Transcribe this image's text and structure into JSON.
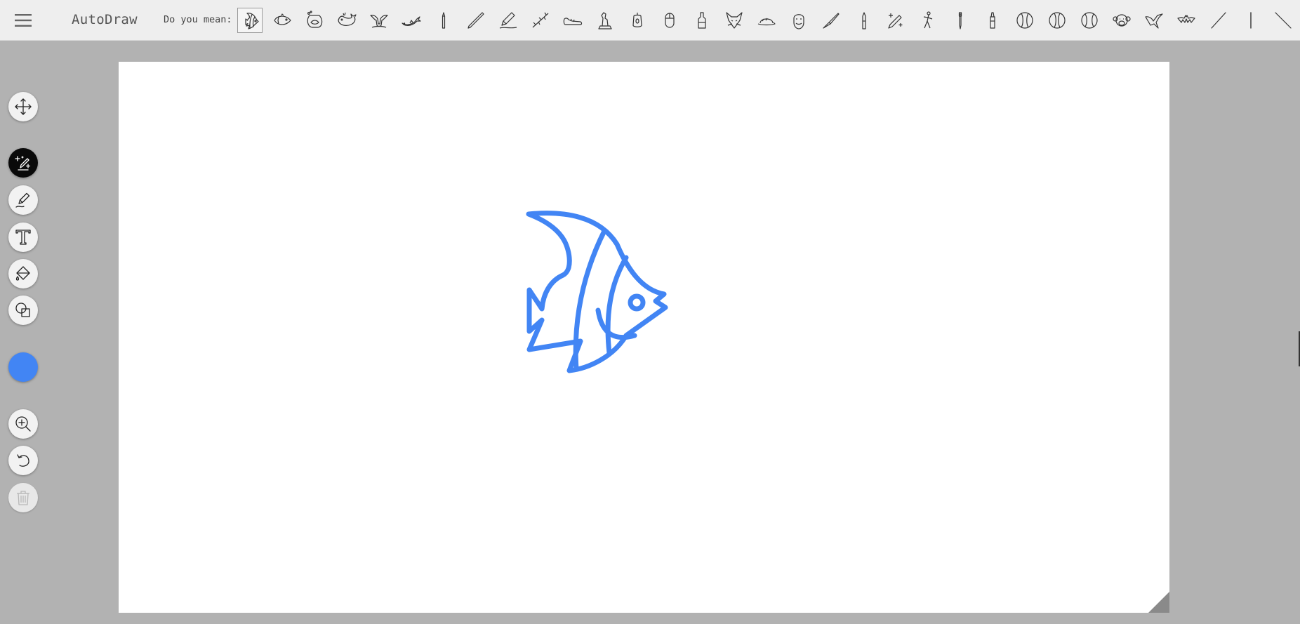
{
  "app": {
    "title": "AutoDraw"
  },
  "header": {
    "did_you_mean_label": "Do you mean:",
    "suggestions": [
      {
        "icon": "angelfish-icon",
        "selected": true
      },
      {
        "icon": "fish-icon"
      },
      {
        "icon": "fish-bowl-icon"
      },
      {
        "icon": "whale-icon"
      },
      {
        "icon": "whale-tail-icon"
      },
      {
        "icon": "dolphin-icon"
      },
      {
        "icon": "crayon-icon"
      },
      {
        "icon": "pencil-line-icon"
      },
      {
        "icon": "pencil-icon"
      },
      {
        "icon": "branch-icon"
      },
      {
        "icon": "shoe-icon"
      },
      {
        "icon": "statue-icon"
      },
      {
        "icon": "lantern-icon"
      },
      {
        "icon": "mouse-icon"
      },
      {
        "icon": "bottle-icon"
      },
      {
        "icon": "fox-icon"
      },
      {
        "icon": "hat-icon"
      },
      {
        "icon": "beard-face-icon"
      },
      {
        "icon": "knife-icon"
      },
      {
        "icon": "marker-icon"
      },
      {
        "icon": "sparkle-pencil-icon"
      },
      {
        "icon": "figure-icon"
      },
      {
        "icon": "pen-icon"
      },
      {
        "icon": "glue-icon"
      },
      {
        "icon": "baseball-icon"
      },
      {
        "icon": "baseball-icon"
      },
      {
        "icon": "baseball-icon"
      },
      {
        "icon": "monkey-icon"
      },
      {
        "icon": "bird-icon"
      },
      {
        "icon": "bat-icon"
      },
      {
        "icon": "line-icon"
      },
      {
        "icon": "vertical-line-icon"
      },
      {
        "icon": "diagonal-line-icon"
      }
    ]
  },
  "toolbar": {
    "tools": [
      {
        "name": "select-tool",
        "icon": "move-icon"
      },
      {
        "name": "autodraw-tool",
        "icon": "autodraw-icon",
        "active": true
      },
      {
        "name": "draw-tool",
        "icon": "pencil-icon"
      },
      {
        "name": "type-tool",
        "icon": "text-icon"
      },
      {
        "name": "fill-tool",
        "icon": "fill-bucket-icon"
      },
      {
        "name": "shape-tool",
        "icon": "shapes-icon"
      },
      {
        "name": "zoom-tool",
        "icon": "zoom-in-icon"
      },
      {
        "name": "undo-tool",
        "icon": "undo-icon"
      },
      {
        "name": "delete-tool",
        "icon": "trash-icon",
        "disabled": true
      }
    ],
    "current_color": "#4285f4"
  },
  "canvas": {
    "drawing": "angelfish",
    "stroke_color": "#4285f4"
  },
  "colors": {
    "background": "#b2b2b2",
    "topbar": "#eeeeee",
    "canvas": "#ffffff",
    "accent": "#4285f4"
  }
}
